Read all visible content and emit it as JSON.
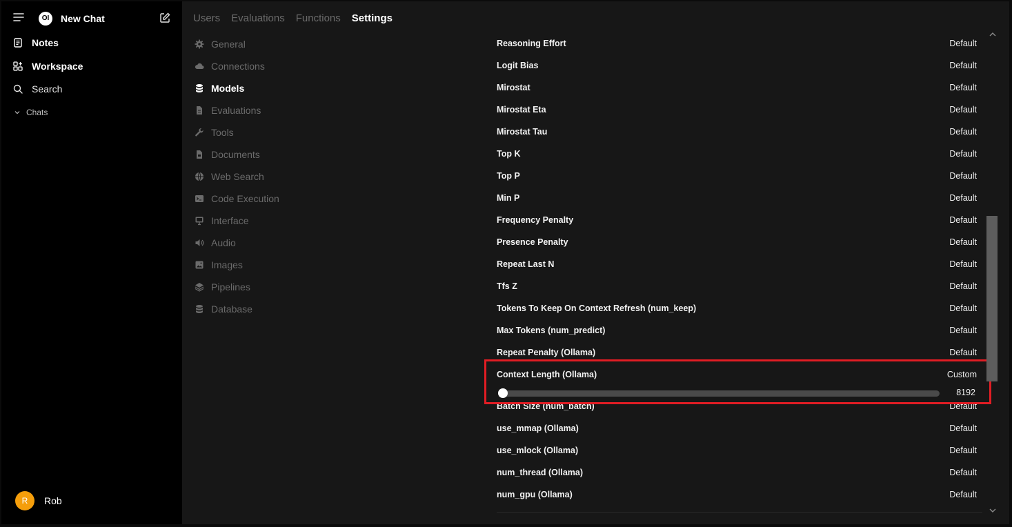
{
  "sidebar": {
    "new_chat_label": "New Chat",
    "logo_text": "OI",
    "items": [
      {
        "label": "Notes",
        "icon": "notes-icon"
      },
      {
        "label": "Workspace",
        "icon": "workspace-icon"
      },
      {
        "label": "Search",
        "icon": "search-icon"
      }
    ],
    "chats_label": "Chats",
    "user": {
      "initial": "R",
      "name": "Rob",
      "avatar_color": "#f59e0b"
    }
  },
  "tabs": [
    "Users",
    "Evaluations",
    "Functions",
    "Settings"
  ],
  "active_tab": "Settings",
  "settings_nav": [
    {
      "label": "General",
      "icon": "gear-icon"
    },
    {
      "label": "Connections",
      "icon": "cloud-icon"
    },
    {
      "label": "Models",
      "icon": "database-icon"
    },
    {
      "label": "Evaluations",
      "icon": "document-icon"
    },
    {
      "label": "Tools",
      "icon": "wrench-icon"
    },
    {
      "label": "Documents",
      "icon": "file-icon"
    },
    {
      "label": "Web Search",
      "icon": "globe-icon"
    },
    {
      "label": "Code Execution",
      "icon": "terminal-icon"
    },
    {
      "label": "Interface",
      "icon": "monitor-icon"
    },
    {
      "label": "Audio",
      "icon": "speaker-icon"
    },
    {
      "label": "Images",
      "icon": "image-icon"
    },
    {
      "label": "Pipelines",
      "icon": "layers-icon"
    },
    {
      "label": "Database",
      "icon": "database-icon"
    }
  ],
  "active_nav": "Models",
  "params": [
    {
      "name": "Reasoning Effort",
      "value": "Default"
    },
    {
      "name": "Logit Bias",
      "value": "Default"
    },
    {
      "name": "Mirostat",
      "value": "Default"
    },
    {
      "name": "Mirostat Eta",
      "value": "Default"
    },
    {
      "name": "Mirostat Tau",
      "value": "Default"
    },
    {
      "name": "Top K",
      "value": "Default"
    },
    {
      "name": "Top P",
      "value": "Default"
    },
    {
      "name": "Min P",
      "value": "Default"
    },
    {
      "name": "Frequency Penalty",
      "value": "Default"
    },
    {
      "name": "Presence Penalty",
      "value": "Default"
    },
    {
      "name": "Repeat Last N",
      "value": "Default"
    },
    {
      "name": "Tfs Z",
      "value": "Default"
    },
    {
      "name": "Tokens To Keep On Context Refresh (num_keep)",
      "value": "Default"
    },
    {
      "name": "Max Tokens (num_predict)",
      "value": "Default"
    },
    {
      "name": "Repeat Penalty (Ollama)",
      "value": "Default"
    },
    {
      "name": "Context Length (Ollama)",
      "value": "Custom",
      "slider_value": "8192"
    },
    {
      "name": "Batch Size (num_batch)",
      "value": "Default"
    },
    {
      "name": "use_mmap (Ollama)",
      "value": "Default"
    },
    {
      "name": "use_mlock (Ollama)",
      "value": "Default"
    },
    {
      "name": "num_thread (Ollama)",
      "value": "Default"
    },
    {
      "name": "num_gpu (Ollama)",
      "value": "Default"
    }
  ],
  "colors": {
    "highlight": "#e11d24",
    "background": "#171717",
    "sidebar": "#000000"
  }
}
